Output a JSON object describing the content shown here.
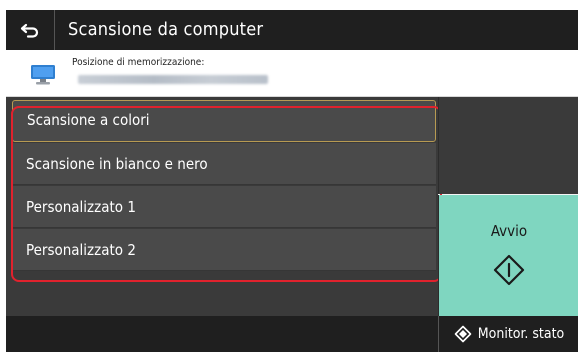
{
  "header": {
    "title": "Scansione da computer",
    "back_icon": "back-arrow-icon"
  },
  "destination": {
    "label": "Posizione di memorizzazione:",
    "icon": "computer-monitor-icon"
  },
  "menu": {
    "items": [
      {
        "label": "Scansione a colori",
        "selected": true
      },
      {
        "label": "Scansione in bianco e nero",
        "selected": false
      },
      {
        "label": "Personalizzato 1",
        "selected": false
      },
      {
        "label": "Personalizzato 2",
        "selected": false
      }
    ]
  },
  "start": {
    "label": "Avvio",
    "icon": "start-diamond-icon"
  },
  "footer": {
    "monitor_label": "Monitor. stato",
    "monitor_icon": "status-monitor-icon"
  },
  "colors": {
    "header_bg": "#1f1f1f",
    "panel_bg": "#3a3a3a",
    "item_bg": "#4a4a4a",
    "start_bg": "#7fd6c0",
    "highlight_border": "#e0222d",
    "selected_border": "#b79a52"
  }
}
